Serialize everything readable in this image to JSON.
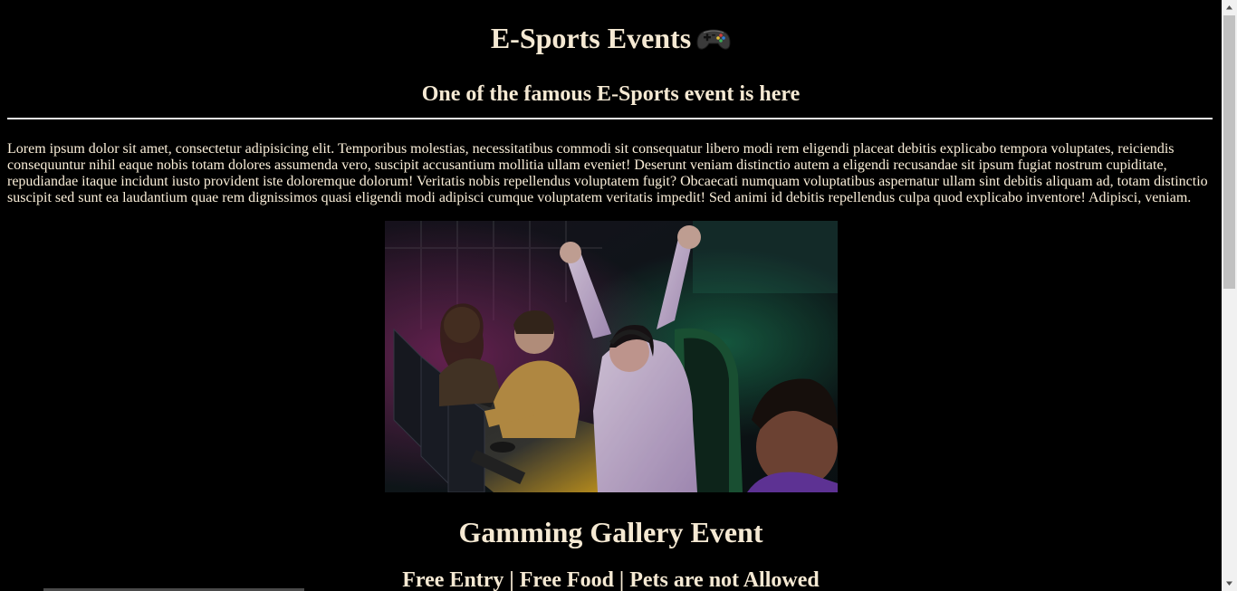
{
  "header": {
    "title": "E-Sports Events",
    "icon": "game-controller-icon",
    "subtitle": "One of the famous E-Sports event is here"
  },
  "intro": {
    "text": "Lorem ipsum dolor sit amet, consectetur adipisicing elit. Temporibus molestias, necessitatibus commodi sit consequatur libero modi rem eligendi placeat debitis explicabo tempora voluptates, reiciendis consequuntur nihil eaque nobis totam dolores assumenda vero, suscipit accusantium mollitia ullam eveniet! Deserunt veniam distinctio autem a eligendi recusandae sit ipsum fugiat nostrum cupiditate, repudiandae itaque incidunt iusto provident iste doloremque dolorum! Veritatis nobis repellendus voluptatem fugit? Obcaecati numquam voluptatibus aspernatur ullam sint debitis aliquam ad, totam distinctio suscipit sed sunt ea laudantium quae rem dignissimos quasi eligendi modi adipisci cumque voluptatem veritatis impedit! Sed animi id debitis repellendus culpa quod explicabo inventore! Adipisci, veniam."
  },
  "gallery": {
    "title": "Gamming Gallery Event",
    "info": "Free Entry | Free Food | Pets are not Allowed"
  },
  "colors": {
    "background": "#000000",
    "text": "#f5e9d3"
  }
}
